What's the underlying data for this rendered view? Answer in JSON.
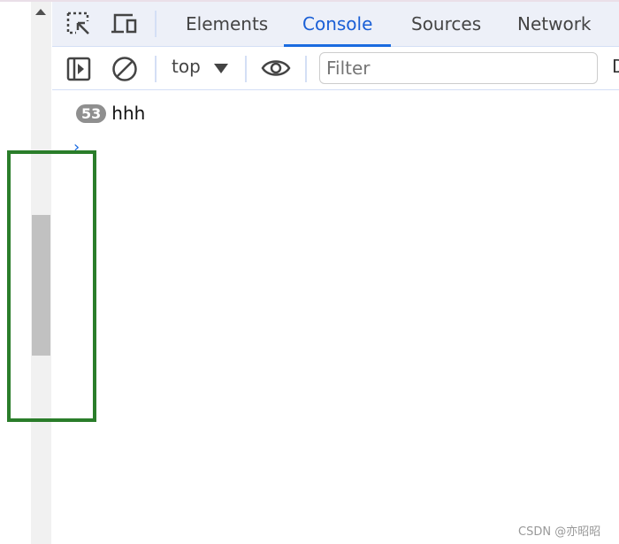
{
  "tabs": [
    {
      "label": "Elements",
      "active": false
    },
    {
      "label": "Console",
      "active": true
    },
    {
      "label": "Sources",
      "active": false
    },
    {
      "label": "Network",
      "active": false
    }
  ],
  "toolbar": {
    "context": "top",
    "filter_placeholder": "Filter",
    "truncated_label": "D"
  },
  "console": {
    "messages": [
      {
        "count": "53",
        "text": "hhh"
      }
    ],
    "prompt": "›"
  },
  "watermark": "CSDN @亦昭昭",
  "colors": {
    "accent": "#1a6be0",
    "highlight": "#2a7d2a"
  },
  "icons": [
    "inspect-element-icon",
    "device-toolbar-icon",
    "sidebar-toggle-icon",
    "clear-console-icon",
    "eye-icon"
  ]
}
